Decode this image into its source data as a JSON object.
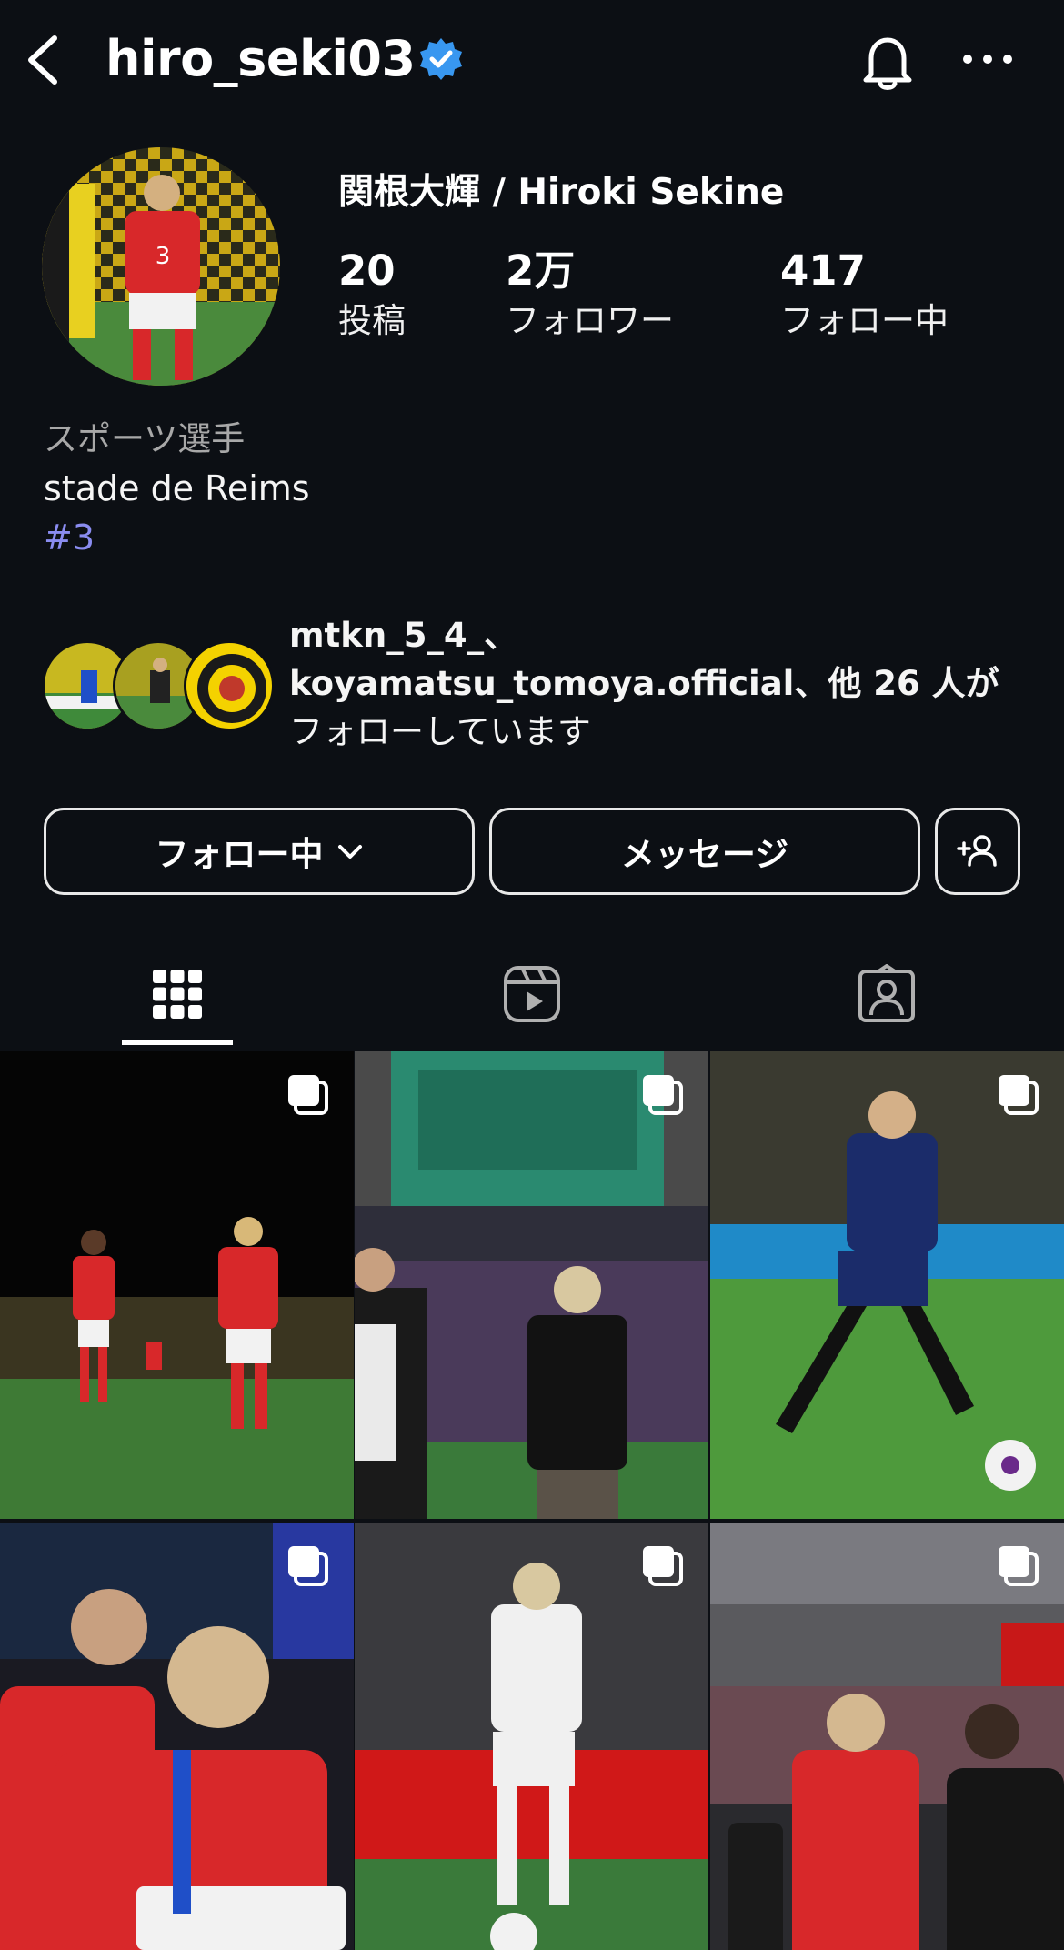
{
  "header": {
    "username": "hiro_seki03",
    "back_icon": "chevron-left-icon",
    "verified_icon": "verified-badge-icon",
    "bell_icon": "bell-icon",
    "more_icon": "more-horizontal-icon"
  },
  "profile": {
    "display_name": "関根大輝 / Hiroki Sekine",
    "stats": [
      {
        "value": "20",
        "label": "投稿"
      },
      {
        "value": "2万",
        "label": "フォロワー"
      },
      {
        "value": "417",
        "label": "フォロー中"
      }
    ],
    "bio": {
      "category": "スポーツ選手",
      "line1": "stade de Reims",
      "hashtag": "#3"
    },
    "mutual": {
      "users": "mtkn_5_4_、",
      "line2": "koyamatsu_tomoya.official、他 26 人が",
      "line3": "フォローしています"
    }
  },
  "actions": {
    "following_label": "フォロー中",
    "message_label": "メッセージ",
    "suggest_icon": "add-person-icon"
  },
  "tabs": [
    {
      "name": "posts",
      "icon": "grid-icon",
      "active": true
    },
    {
      "name": "reels",
      "icon": "reels-icon",
      "active": false
    },
    {
      "name": "tagged",
      "icon": "tagged-person-icon",
      "active": false
    }
  ],
  "colors": {
    "background": "#0c0f14",
    "verified": "#3897f0",
    "hashtag": "#8a8cf0"
  }
}
